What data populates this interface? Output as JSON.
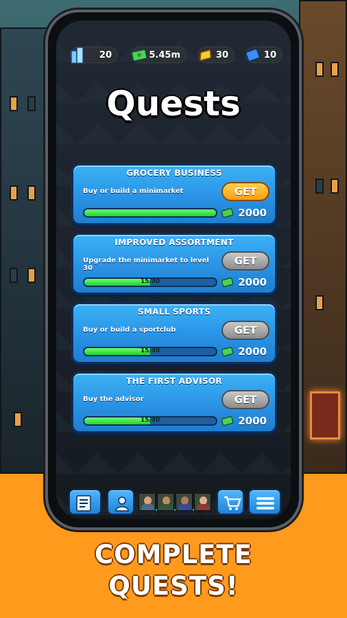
{
  "stats": {
    "buildings": "20",
    "cash": "5.45m",
    "gold": "30",
    "tickets": "10"
  },
  "title": "Quests",
  "quests": [
    {
      "title": "GROCERY BUSINESS",
      "description": "Buy or build a minimarket",
      "button": "GET",
      "active": true,
      "progress_text": "",
      "progress": 1.0,
      "reward": "2000"
    },
    {
      "title": "IMPROVED ASSORTMENT",
      "description": "Upgrade the minimarket to level 30",
      "button": "GET",
      "active": false,
      "progress_text": "15/30",
      "progress": 0.5,
      "reward": "2000"
    },
    {
      "title": "SMALL SPORTS",
      "description": "Buy or build a sportclub",
      "button": "GET",
      "active": false,
      "progress_text": "15/30",
      "progress": 0.5,
      "reward": "2000"
    },
    {
      "title": "THE FIRST ADVISOR",
      "description": "Buy the advisor",
      "button": "GET",
      "active": false,
      "progress_text": "15/30",
      "progress": 0.5,
      "reward": "2000"
    }
  ],
  "tagline": {
    "line1": "COMPLETE",
    "line2": "QUESTS!"
  },
  "colors": {
    "accent_orange": "#ff9a1d",
    "card_blue": "#2a92e4",
    "progress_green": "#1ed12e",
    "get_active": "#ffb42a"
  },
  "icons": [
    "buildings-icon",
    "cash-icon",
    "gold-bar-icon",
    "ticket-icon",
    "quest-list-icon",
    "advisor-icon",
    "shop-cart-icon",
    "menu-icon"
  ]
}
